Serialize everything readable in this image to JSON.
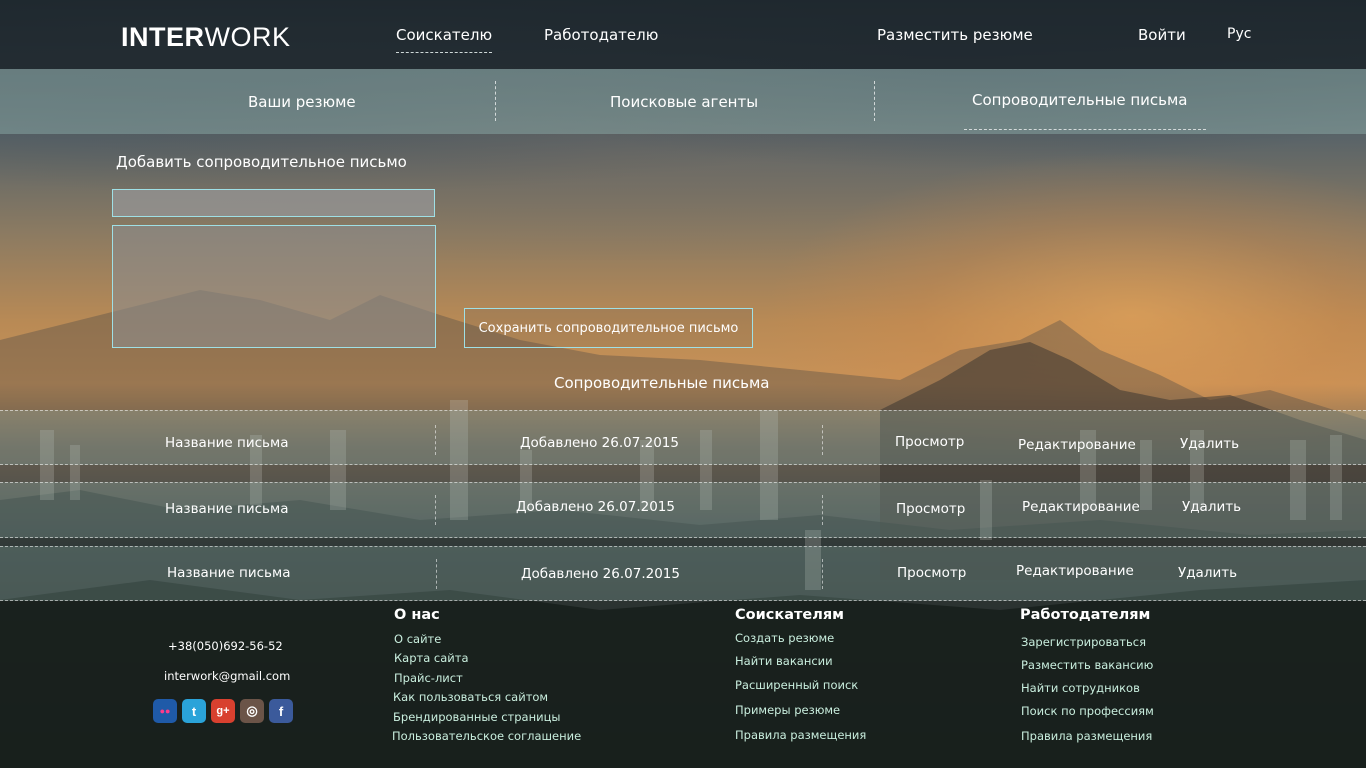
{
  "header": {
    "logo_bold": "INTER",
    "logo_light": "WORK",
    "nav": {
      "seekers": "Соискателю",
      "employers": "Работодателю",
      "post_resume": "Разместить резюме",
      "login": "Войти",
      "language": "Рус"
    }
  },
  "subnav": {
    "resumes": "Ваши резюме",
    "agents": "Поисковые агенты",
    "cover_letters": "Сопроводительные письма"
  },
  "form": {
    "title": "Добавить сопроводительное письмо",
    "title_value": "",
    "body_value": "",
    "save_label": "Сохранить сопроводительное письмо"
  },
  "letters": {
    "title": "Сопроводительные письма",
    "rows": [
      {
        "name": "Название письма",
        "added": "Добавлено 26.07.2015",
        "view": "Просмотр",
        "edit": "Редактирование",
        "delete": "Удалить"
      },
      {
        "name": "Название письма",
        "added": "Добавлено 26.07.2015",
        "view": "Просмотр",
        "edit": "Редактирование",
        "delete": "Удалить"
      },
      {
        "name": "Название письма",
        "added": "Добавлено 26.07.2015",
        "view": "Просмотр",
        "edit": "Редактирование",
        "delete": "Удалить"
      }
    ]
  },
  "footer": {
    "phone": "+38(050)692-56-52",
    "email": "interwork@gmail.com",
    "social": [
      {
        "name": "flickr-icon",
        "glyph": "●●",
        "color": "#1f5aa8"
      },
      {
        "name": "twitter-icon",
        "glyph": "t",
        "color": "#2aa3d9"
      },
      {
        "name": "google-plus-icon",
        "glyph": "g+",
        "color": "#d8402f"
      },
      {
        "name": "instagram-icon",
        "glyph": "◎",
        "color": "#6b5448"
      },
      {
        "name": "facebook-icon",
        "glyph": "f",
        "color": "#3b5a9b"
      }
    ],
    "about": {
      "heading": "О нас",
      "links": [
        "О сайте",
        "Карта сайта",
        "Прайс-лист",
        "Как пользоваться сайтом",
        "Брендированные страницы",
        "Пользовательское соглашение"
      ]
    },
    "seekers": {
      "heading": "Соискателям",
      "links": [
        "Создать резюме",
        "Найти вакансии",
        "Расширенный поиск",
        "Примеры резюме",
        "Правила размещения"
      ]
    },
    "employers": {
      "heading": "Работодателям",
      "links": [
        "Зарегистрироваться",
        "Разместить вакансию",
        "Найти сотрудников",
        "Поиск по профессиям",
        "Правила размещения"
      ]
    }
  }
}
